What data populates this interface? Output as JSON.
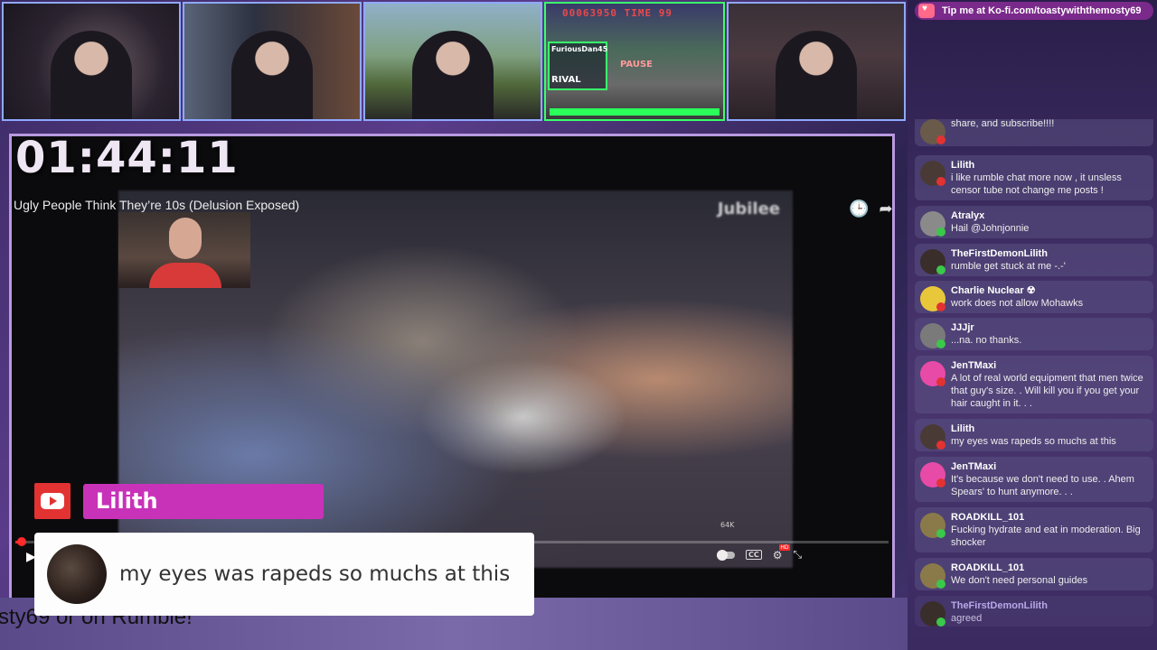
{
  "stream": {
    "timer": "01:44:11",
    "ticker_text": "sty69 or on Rumble!"
  },
  "game_hud": {
    "score_line": "00063950  TIME  99",
    "player_tag": "FuriousDan45",
    "rival_label": "RIVAL",
    "pause_label": "PAUSE"
  },
  "video": {
    "title": "Ugly People Think They’re 10s (Delusion Exposed)",
    "channel_logo": "Jubilee",
    "progress_fraction": 0.004,
    "small_actions": "64K"
  },
  "featured_chat": {
    "name": "Lilith",
    "message": "my eyes was rapeds so muchs at this",
    "source": "youtube"
  },
  "tip_banner": {
    "text": "Tip me at Ko-fi.com/toastywiththemosty69"
  },
  "chat": [
    {
      "name": "",
      "message": "share, and subscribe!!!!",
      "source": "youtube",
      "avatar_color": "#6a5a4a"
    },
    {
      "name": "Lilith",
      "message": "i like rumble chat more now , it unsless censor tube not change me posts !",
      "source": "youtube",
      "avatar_color": "#4a3a36"
    },
    {
      "name": "Atralyx",
      "message": "Hail @Johnjonnie",
      "source": "rumble",
      "avatar_color": "#8a8a8a"
    },
    {
      "name": "TheFirstDemonLilith",
      "message": "rumble get stuck at me -.-'",
      "source": "rumble",
      "avatar_color": "#3a2e2a"
    },
    {
      "name": "Charlie Nuclear ☢",
      "message": "work does not allow Mohawks",
      "source": "youtube",
      "avatar_color": "#e8c83a"
    },
    {
      "name": "JJJjr",
      "message": "...na. no thanks.",
      "source": "rumble",
      "avatar_color": "#7a7a7a"
    },
    {
      "name": "JenTMaxi",
      "message": "A lot of real world equipment that men twice that guy's size. . Will kill you if you get your hair caught in it. . .",
      "source": "youtube",
      "avatar_color": "#e84aa8"
    },
    {
      "name": "Lilith",
      "message": "my eyes was rapeds so muchs at this",
      "source": "youtube",
      "avatar_color": "#4a3a36"
    },
    {
      "name": "JenTMaxi",
      "message": "It's because we don't need to use. . Ahem Spears' to hunt anymore. . .",
      "source": "youtube",
      "avatar_color": "#e84aa8"
    },
    {
      "name": "ROADKILL_101",
      "message": "Fucking hydrate and eat in moderation. Big shocker",
      "source": "rumble",
      "avatar_color": "#8a7a4a"
    },
    {
      "name": "ROADKILL_101",
      "message": "We don't need personal guides",
      "source": "rumble",
      "avatar_color": "#8a7a4a"
    },
    {
      "name": "TheFirstDemonLilith",
      "message": "agreed",
      "source": "rumble",
      "avatar_color": "#3a2e2a",
      "faded": true
    }
  ]
}
